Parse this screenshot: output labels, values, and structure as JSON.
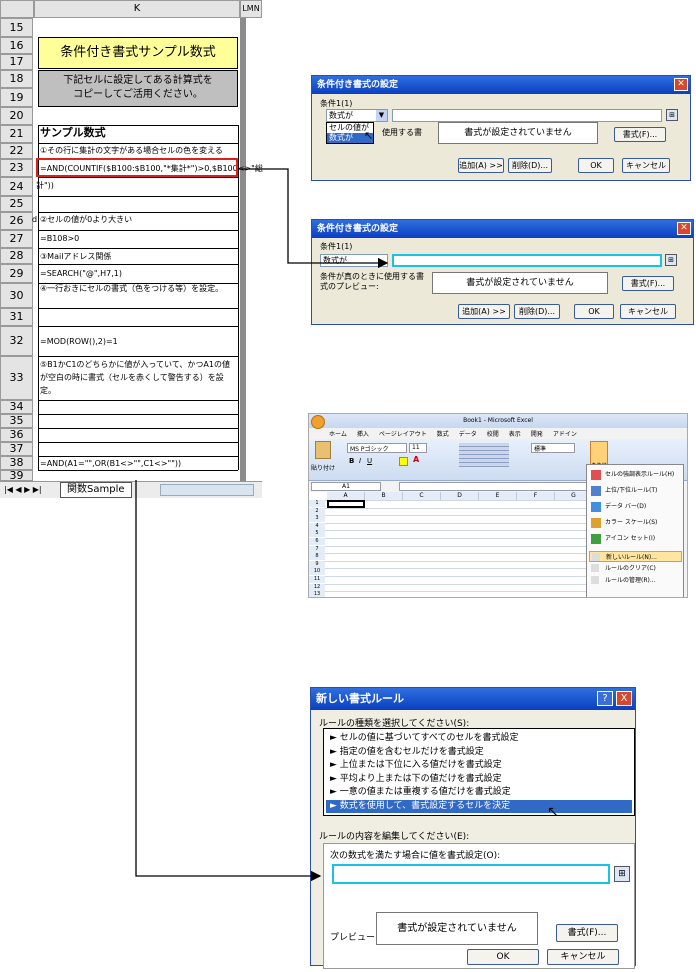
{
  "sheet": {
    "col_k": "K",
    "col_right": "LMN",
    "rows": [
      "15",
      "16",
      "17",
      "18",
      "19",
      "20",
      "21",
      "22",
      "23",
      "24",
      "25",
      "26",
      "27",
      "28",
      "29",
      "30",
      "31",
      "32",
      "33",
      "34",
      "35",
      "36",
      "37",
      "38",
      "39"
    ],
    "title1": "条件付き書式サンプル数式",
    "title2_line1": "下記セルに設定してある計算式を",
    "title2_line2": "コピーしてご活用ください。",
    "heading": "サンプル数式",
    "r22": "①その行に集計の文字がある場合セルの色を変える",
    "r23": "=AND(COUNTIF($B100:$B100,\"*集計*\")>0,$B100<>\"総",
    "r24": "計\"))",
    "r26_prefix": "d",
    "r26": "②セルの値が0より大きい",
    "r27": "=B108>0",
    "r28": "③Mailアドレス関係",
    "r29": "=SEARCH(\"@\",H7,1)",
    "r30": "④一行おきにセルの書式（色をつける等）を設定。",
    "r32": "=MOD(ROW(),2)=1",
    "r33": "⑤B1かC1のどちらかに値が入っていて、かつA1の値が空白の時に書式（セルを赤くして警告する）を設定。",
    "r38": "=AND(A1=\"\",OR(B1<>\"\",C1<>\"\"))",
    "tab_label": "関数Sample",
    "tab_nav": "|◀ ◀ ▶ ▶|"
  },
  "dialog1": {
    "title": "条件付き書式の設定",
    "condition_label": "条件1(1)",
    "combo_value": "数式が",
    "dd_option1": "セルの値が",
    "dd_option2": "数式が",
    "preview_label": "使用する書",
    "preview_text": "書式が設定されていません",
    "format_button": "書式(F)...",
    "add_button": "追加(A) >>",
    "delete_button": "削除(D)...",
    "ok_button": "OK",
    "cancel_button": "キャンセル"
  },
  "dialog2": {
    "title": "条件付き書式の設定",
    "condition_label": "条件1(1)",
    "combo_value": "数式が",
    "preview_label_line1": "条件が真のときに使用する書",
    "preview_label_line2": "式のプレビュー:",
    "preview_text": "書式が設定されていません",
    "format_button": "書式(F)...",
    "add_button": "追加(A) >>",
    "delete_button": "削除(D)...",
    "ok_button": "OK",
    "cancel_button": "キャンセル"
  },
  "ribbon": {
    "window_title": "Book1 - Microsoft Excel",
    "tabs": [
      "ホーム",
      "挿入",
      "ページレイアウト",
      "数式",
      "データ",
      "校閲",
      "表示",
      "開発",
      "アドイン"
    ],
    "paste": "貼り付け",
    "font_name": "MS Pゴシック",
    "font_size": "11",
    "number_format": "標準",
    "name_box": "A1",
    "cond_format_btn": "条件付き書式",
    "menu": [
      "セルの強調表示ルール(H)",
      "上位/下位ルール(T)",
      "データ バー(D)",
      "カラー スケール(S)",
      "アイコン セット(I)",
      "新しいルール(N)...",
      "ルールのクリア(C)",
      "ルールの管理(R)..."
    ],
    "rows": [
      "1",
      "2",
      "3",
      "4",
      "5",
      "6",
      "7",
      "8",
      "9",
      "10",
      "11",
      "12",
      "13"
    ],
    "cols": [
      "A",
      "B",
      "C",
      "D",
      "E",
      "F",
      "G"
    ]
  },
  "newrule": {
    "title": "新しい書式ルール",
    "select_type_label": "ルールの種類を選択してください(S):",
    "rule_types": [
      "► セルの値に基づいてすべてのセルを書式設定",
      "► 指定の値を含むセルだけを書式設定",
      "► 上位または下位に入る値だけを書式設定",
      "► 平均より上または下の値だけを書式設定",
      "► 一意の値または重複する値だけを書式設定",
      "► 数式を使用して、書式設定するセルを決定"
    ],
    "edit_label": "ルールの内容を編集してください(E):",
    "formula_label": "次の数式を満たす場合に値を書式設定(O):",
    "preview_label": "プレビュー:",
    "preview_text": "書式が設定されていません",
    "format_button": "書式(F)...",
    "ok_button": "OK",
    "cancel_button": "キャンセル",
    "help": "?",
    "close": "X"
  },
  "colors": {
    "title_yellow": "#ffff99",
    "title_grey": "#bfbfbf",
    "highlight_red": "#e01e1e",
    "selection_blue": "#316ac5",
    "dialog_bg": "#ece9d8",
    "cyan_border": "#19c3e6"
  }
}
